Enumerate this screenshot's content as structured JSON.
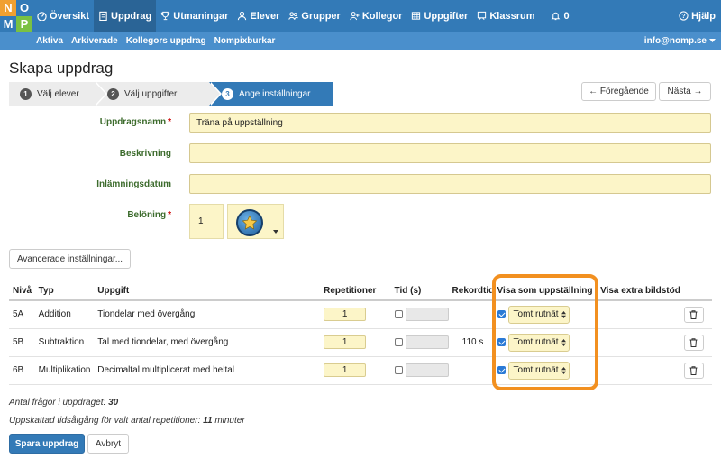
{
  "logo": {
    "letters": [
      "N",
      "O",
      "M",
      "P"
    ],
    "colors": [
      "#f0a030",
      "#337ab7",
      "#337ab7",
      "#7ac142"
    ]
  },
  "nav": {
    "items": [
      {
        "label": "Översikt",
        "icon": "dashboard-icon"
      },
      {
        "label": "Uppdrag",
        "icon": "clipboard-icon",
        "active": true
      },
      {
        "label": "Utmaningar",
        "icon": "trophy-icon"
      },
      {
        "label": "Elever",
        "icon": "user-icon"
      },
      {
        "label": "Grupper",
        "icon": "users-icon"
      },
      {
        "label": "Kollegor",
        "icon": "user-plus-icon"
      },
      {
        "label": "Uppgifter",
        "icon": "table-icon"
      },
      {
        "label": "Klassrum",
        "icon": "chalkboard-icon"
      },
      {
        "label": "0",
        "icon": "bell-icon"
      }
    ],
    "help": "Hjälp"
  },
  "subnav": {
    "items": [
      "Aktiva",
      "Arkiverade",
      "Kollegors uppdrag",
      "Nompixburkar"
    ],
    "account": "info@nomp.se"
  },
  "page_title": "Skapa uppdrag",
  "wizard": {
    "steps": [
      {
        "num": "1",
        "label": "Välj elever"
      },
      {
        "num": "2",
        "label": "Välj uppgifter"
      },
      {
        "num": "3",
        "label": "Ange inställningar"
      }
    ],
    "prev": "← Föregående",
    "next": "Nästa →"
  },
  "form": {
    "name_label": "Uppdragsnamn",
    "name_value": "Träna på uppställning",
    "desc_label": "Beskrivning",
    "desc_value": "",
    "date_label": "Inlämningsdatum",
    "date_value": "",
    "reward_label": "Belöning",
    "reward_value": "1",
    "required_mark": "*"
  },
  "advanced_button": "Avancerade inställningar...",
  "table": {
    "headers": [
      "Nivå",
      "Typ",
      "Uppgift",
      "Repetitioner",
      "Tid (s)",
      "Rekordtid",
      "Visa som uppställning",
      "Visa extra bildstöd"
    ],
    "rows": [
      {
        "level": "5A",
        "type": "Addition",
        "task": "Tiondelar med övergång",
        "reps": "1",
        "record": "",
        "display": "Tomt rutnät"
      },
      {
        "level": "5B",
        "type": "Subtraktion",
        "task": "Tal med tiondelar, med övergång",
        "reps": "1",
        "record": "110 s",
        "display": "Tomt rutnät"
      },
      {
        "level": "6B",
        "type": "Multiplikation",
        "task": "Decimaltal multiplicerat med heltal",
        "reps": "1",
        "record": "",
        "display": "Tomt rutnät"
      }
    ]
  },
  "summary": {
    "questions_text": "Antal frågor i uppdraget:",
    "questions_value": "30",
    "time_text": "Uppskattad tidsåtgång för valt antal repetitioner:",
    "time_value": "11",
    "time_unit": "minuter"
  },
  "actions": {
    "save": "Spara uppdrag",
    "cancel": "Avbryt"
  },
  "colors": {
    "primary": "#337ab7",
    "highlight": "#f29020",
    "field_bg": "#fcf5c8",
    "label_green": "#3c6b2c"
  }
}
